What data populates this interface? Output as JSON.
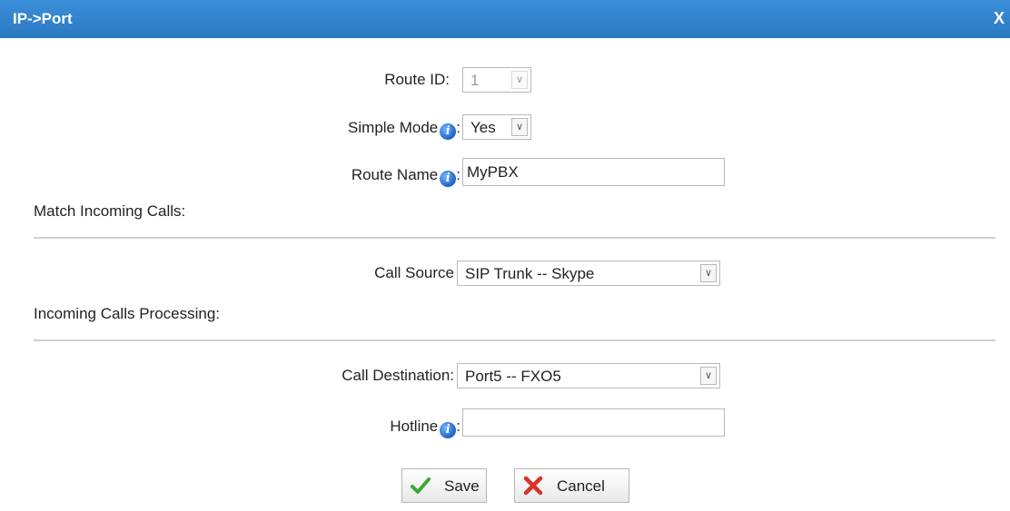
{
  "dialog": {
    "title": "IP->Port",
    "close_label": "X"
  },
  "form": {
    "route_id": {
      "label": "Route ID:",
      "value": "1"
    },
    "simple_mode": {
      "label": "Simple Mode",
      "colon": ":",
      "value": "Yes"
    },
    "route_name": {
      "label": "Route Name",
      "colon": ":",
      "value": "MyPBX"
    },
    "match_section": "Match Incoming Calls:",
    "call_source": {
      "label": "Call Source",
      "value": "SIP Trunk -- Skype"
    },
    "processing_section": "Incoming Calls Processing:",
    "call_destination": {
      "label": "Call Destination:",
      "value": "Port5 -- FXO5"
    },
    "hotline": {
      "label": "Hotline",
      "colon": ":",
      "value": ""
    }
  },
  "buttons": {
    "save_label": "Save",
    "cancel_label": "Cancel"
  },
  "icons": {
    "info": "info-icon",
    "arrow": "chevron-down-icon",
    "save": "checkmark-icon",
    "cancel": "x-mark-icon"
  },
  "colors": {
    "titlebar": "#2b78c2",
    "save_check": "#3aaa35",
    "cancel_x": "#d8322b"
  }
}
